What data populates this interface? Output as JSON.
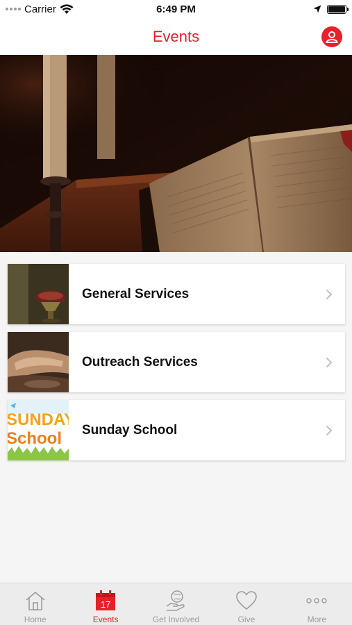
{
  "status_bar": {
    "carrier": "Carrier",
    "time": "6:49 PM"
  },
  "nav": {
    "title": "Events",
    "profile_icon": "person-icon",
    "accent_color": "#e8202a"
  },
  "hero": {
    "image": "candles-and-open-bible"
  },
  "events": [
    {
      "label": "General Services",
      "thumbnail": "communion-chalice"
    },
    {
      "label": "Outreach Services",
      "thumbnail": "washing-feet"
    },
    {
      "label": "Sunday School",
      "thumbnail": "sunday-school-lettering",
      "thumbnail_text_line1": "SUNDAY",
      "thumbnail_text_line2": "School"
    }
  ],
  "tab_bar": {
    "items": [
      {
        "label": "Home",
        "icon": "house-icon",
        "active": false
      },
      {
        "label": "Events",
        "icon": "calendar-icon",
        "icon_text": "17",
        "active": true
      },
      {
        "label": "Get Involved",
        "icon": "hand-globe-icon",
        "active": false
      },
      {
        "label": "Give",
        "icon": "heart-icon",
        "active": false
      },
      {
        "label": "More",
        "icon": "more-dots-icon",
        "active": false
      }
    ]
  }
}
